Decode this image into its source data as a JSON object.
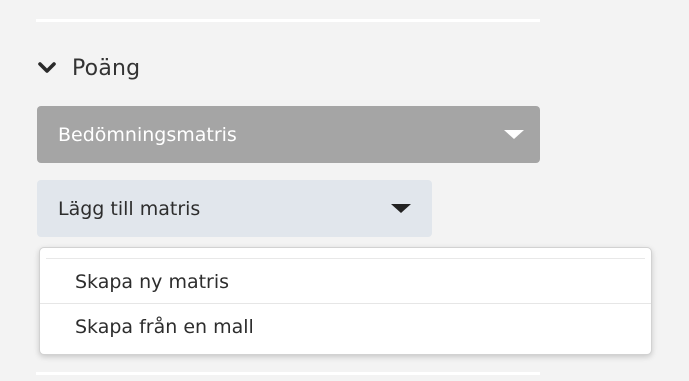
{
  "section": {
    "title": "Poäng",
    "expand_icon": "chevron-down-icon"
  },
  "matrix_dropdown": {
    "selected": "Bedömningsmatris",
    "caret_icon": "caret-down-icon",
    "color": "#a5a5a5"
  },
  "add_matrix_dropdown": {
    "label": "Lägg till matris",
    "caret_icon": "caret-down-icon",
    "color": "#e1e6ec",
    "menu": {
      "items": [
        {
          "label": "Skapa ny matris"
        },
        {
          "label": "Skapa från en mall"
        }
      ]
    }
  }
}
